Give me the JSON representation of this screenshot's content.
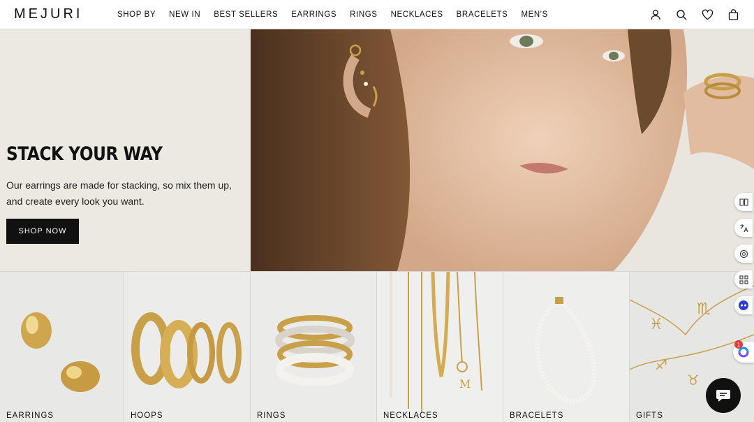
{
  "brand": {
    "logo": "MEJURI"
  },
  "nav": {
    "items": [
      {
        "label": "SHOP BY"
      },
      {
        "label": "NEW IN"
      },
      {
        "label": "BEST SELLERS"
      },
      {
        "label": "EARRINGS"
      },
      {
        "label": "RINGS"
      },
      {
        "label": "NECKLACES"
      },
      {
        "label": "BRACELETS"
      },
      {
        "label": "MEN'S"
      }
    ]
  },
  "header_icons": [
    "account-icon",
    "search-icon",
    "wishlist-heart-icon",
    "bag-icon"
  ],
  "hero": {
    "title": "STACK YOUR WAY",
    "description": "Our earrings are made for stacking, so mix them up, and create every look you want.",
    "cta_label": "SHOP NOW"
  },
  "categories": [
    {
      "label": "EARRINGS"
    },
    {
      "label": "HOOPS"
    },
    {
      "label": "RINGS"
    },
    {
      "label": "NECKLACES"
    },
    {
      "label": "BRACELETS"
    },
    {
      "label": "GIFTS"
    }
  ],
  "side_tools": [
    "reader-icon",
    "translate-icon",
    "audio-icon",
    "apps-icon",
    "assistant-icon"
  ],
  "extension_badge": "1",
  "colors": {
    "hero_bg": "#ece8e2",
    "button_bg": "#111111",
    "gold": "#c9a04a"
  }
}
